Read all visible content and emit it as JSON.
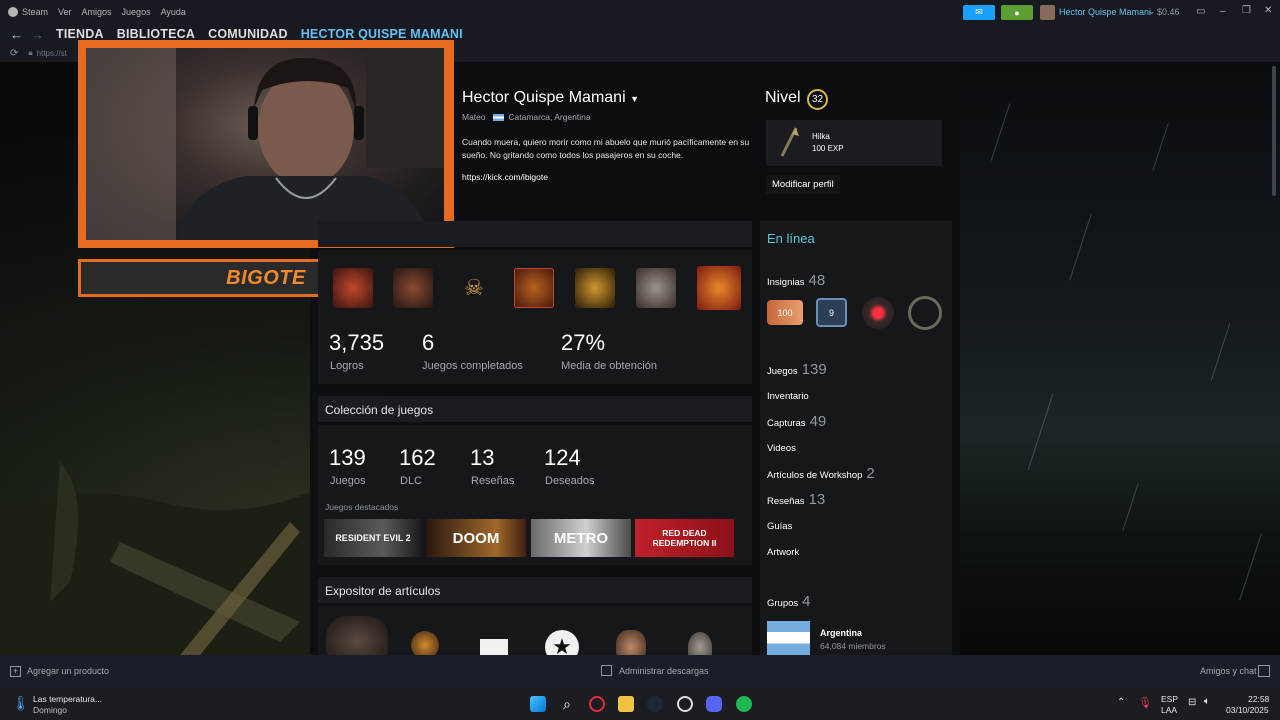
{
  "titlebar": {
    "menu": [
      "Steam",
      "Ver",
      "Amigos",
      "Juegos",
      "Ayuda"
    ],
    "user_name": "Hector Quispe Mamani",
    "balance": "$0.46"
  },
  "nav": {
    "tabs": [
      "TIENDA",
      "BIBLIOTECA",
      "COMUNIDAD",
      "HECTOR QUISPE MAMANI"
    ],
    "url_prefix": "https://st"
  },
  "webcam": {
    "name_overlay": "BIGOTE"
  },
  "profile": {
    "name": "Hector Quispe Mamani",
    "real_name": "Mateo",
    "location": "Catamarca, Argentina",
    "bio": "Cuando muera, quiero morir como mi abuelo que murió pacíficamente en su sueño. No gritando como todos los pasajeros en su coche.",
    "link": "https://kick.com/ibigote",
    "level_label": "Nivel",
    "level": "32",
    "featured_badge": {
      "name": "Hilka",
      "xp": "100 EXP"
    },
    "edit_button": "Modificar perfil"
  },
  "achievements": {
    "total": "3,735",
    "total_label": "Logros",
    "completed": "6",
    "completed_label": "Juegos completados",
    "rate": "27%",
    "rate_label": "Media de obtención"
  },
  "collection": {
    "header": "Colección de juegos",
    "stats": [
      {
        "value": "139",
        "label": "Juegos"
      },
      {
        "value": "162",
        "label": "DLC"
      },
      {
        "value": "13",
        "label": "Reseñas"
      },
      {
        "value": "124",
        "label": "Deseados"
      }
    ],
    "featured_label": "Juegos destacados",
    "featured_games": [
      "RESIDENT EVIL 2",
      "DOOM",
      "METRO",
      "RED DEAD REDEMPTION II"
    ]
  },
  "showcase": {
    "header": "Expositor de artículos"
  },
  "sidebar": {
    "status": "En línea",
    "badges_label": "Insignias",
    "badges_count": "48",
    "games_label": "Juegos",
    "games_count": "139",
    "inventory_label": "Inventario",
    "screenshots_label": "Capturas",
    "screenshots_count": "49",
    "videos_label": "Videos",
    "workshop_label": "Artículos de Workshop",
    "workshop_count": "2",
    "reviews_label": "Reseñas",
    "reviews_count": "13",
    "guides_label": "Guías",
    "artwork_label": "Artwork",
    "groups_label": "Grupos",
    "groups_count": "4",
    "group": {
      "name": "Argentina",
      "members": "64,084 miembros"
    }
  },
  "bottom_bar": {
    "add_product": "Agregar un producto",
    "downloads": "Administrar descargas",
    "friends_chat": "Amigos y chat"
  },
  "taskbar": {
    "weather_title": "Las temperatura...",
    "weather_sub": "Domingo",
    "lang_top": "ESP",
    "lang_bottom": "LAA",
    "time": "22:58",
    "date": "03/10/2025"
  },
  "colors": {
    "accent_orange": "#e56b20",
    "steam_blue": "#66c0f4",
    "level_gold": "#d9b845"
  }
}
